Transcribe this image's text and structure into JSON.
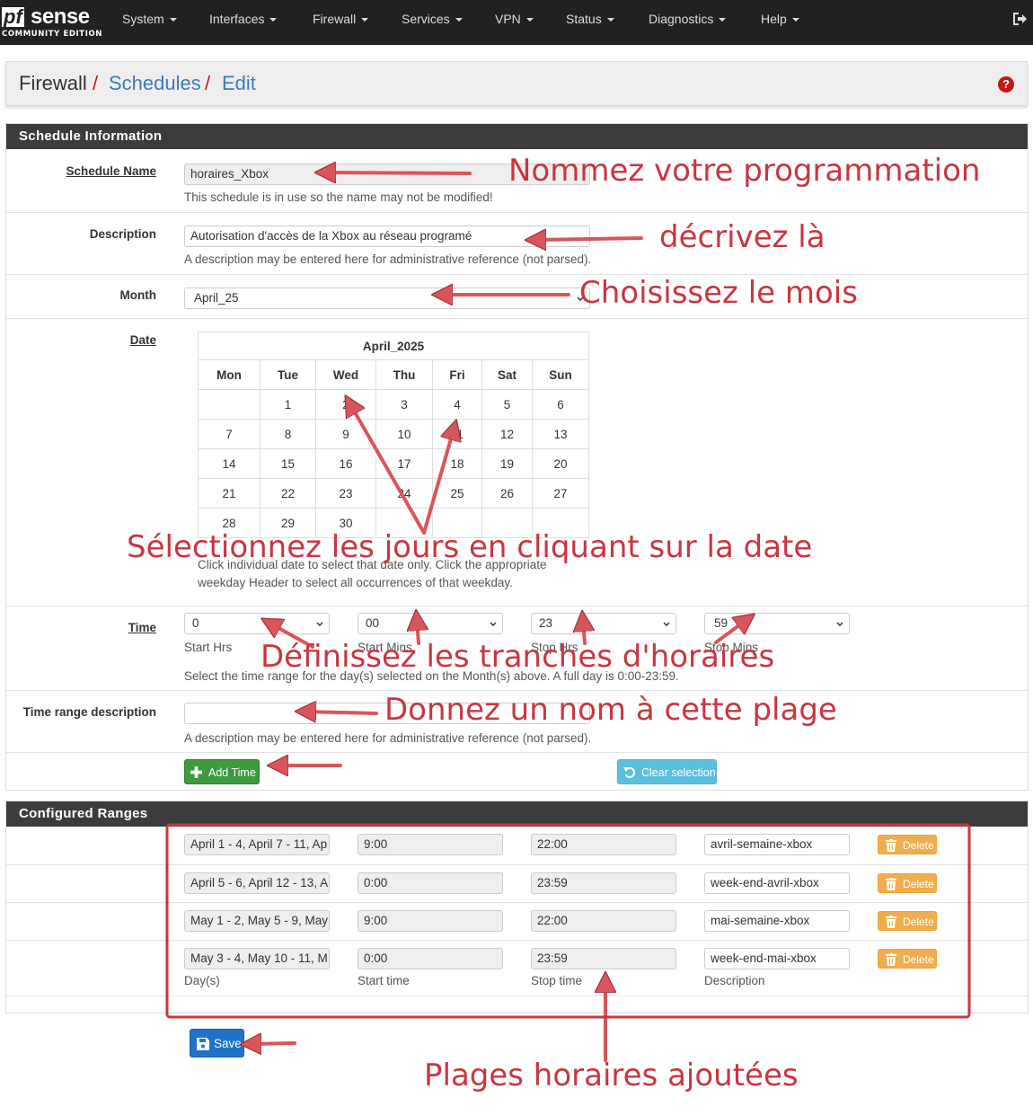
{
  "navbar": {
    "logo_pf": "pf",
    "logo_sense": "sense",
    "logo_edition": "COMMUNITY EDITION",
    "items": [
      "System",
      "Interfaces",
      "Firewall",
      "Services",
      "VPN",
      "Status",
      "Diagnostics",
      "Help"
    ],
    "logout_icon": "sign-out-icon"
  },
  "breadcrumb": {
    "items": [
      "Firewall",
      "Schedules",
      "Edit"
    ],
    "separator": "/",
    "help_icon": "question-circle-icon"
  },
  "schedule_info": {
    "title": "Schedule Information",
    "name_label": "Schedule Name",
    "name_value": "horaires_Xbox",
    "name_help": "This schedule is in use so the name may not be modified!",
    "description_label": "Description",
    "description_value": "Autorisation d'accès de la Xbox au réseau programé",
    "description_help": "A description may be entered here for administrative reference (not parsed).",
    "month_label": "Month",
    "month_value": "April_25",
    "date_label": "Date",
    "calendar": {
      "title": "April_2025",
      "weekdays": [
        "Mon",
        "Tue",
        "Wed",
        "Thu",
        "Fri",
        "Sat",
        "Sun"
      ],
      "weeks": [
        [
          "",
          "1",
          "2",
          "3",
          "4",
          "5",
          "6"
        ],
        [
          "7",
          "8",
          "9",
          "10",
          "11",
          "12",
          "13"
        ],
        [
          "14",
          "15",
          "16",
          "17",
          "18",
          "19",
          "20"
        ],
        [
          "21",
          "22",
          "23",
          "24",
          "25",
          "26",
          "27"
        ],
        [
          "28",
          "29",
          "30",
          "",
          "",
          "",
          ""
        ]
      ]
    },
    "date_help_1": "Click individual date to select that date only. Click the appropriate",
    "date_help_2": "weekday Header to select all occurrences of that weekday.",
    "time_label": "Time",
    "time": {
      "start_hrs": "0",
      "start_hrs_label": "Start Hrs",
      "start_mins": "00",
      "start_mins_label": "Start Mins",
      "stop_hrs": "23",
      "stop_hrs_label": "Stop Hrs",
      "stop_mins": "59",
      "stop_mins_label": "Stop Mins"
    },
    "time_help": "Select the time range for the day(s) selected on the Month(s) above. A full day is 0:00-23:59.",
    "range_desc_label": "Time range description",
    "range_desc_value": "",
    "range_desc_help": "A description may be entered here for administrative reference (not parsed).",
    "add_time_button": "Add Time",
    "clear_selection_button": "Clear selection"
  },
  "configured_ranges": {
    "title": "Configured Ranges",
    "rows": [
      {
        "days": "April 1 - 4, April 7 - 11, Ap",
        "start": "9:00",
        "stop": "22:00",
        "description": "avril-semaine-xbox"
      },
      {
        "days": "April 5 - 6, April 12 - 13, A",
        "start": "0:00",
        "stop": "23:59",
        "description": "week-end-avril-xbox"
      },
      {
        "days": "May 1 - 2, May 5 - 9, May",
        "start": "9:00",
        "stop": "22:00",
        "description": "mai-semaine-xbox"
      },
      {
        "days": "May 3 - 4, May 10 - 11, M",
        "start": "0:00",
        "stop": "23:59",
        "description": "week-end-mai-xbox"
      }
    ],
    "delete_label": "Delete",
    "col_days": "Day(s)",
    "col_start": "Start time",
    "col_stop": "Stop time",
    "col_description": "Description"
  },
  "save_button": "Save",
  "annotations": {
    "name": "Nommez votre  programmation",
    "describe": "décrivez là",
    "month": "Choisissez le mois",
    "days": "Sélectionnez les jours en cliquant  sur la date",
    "times": "Définissez les tranches d'horaires",
    "range_name": "Donnez un nom à cette  plage",
    "ranges": "Plages horaires ajoutées"
  },
  "colors": {
    "navbar": "#212121",
    "accent_red": "#c11b17",
    "link_blue": "#3d7ab8",
    "annotation": "#c8363f",
    "panel_header": "#3c3c3c"
  }
}
